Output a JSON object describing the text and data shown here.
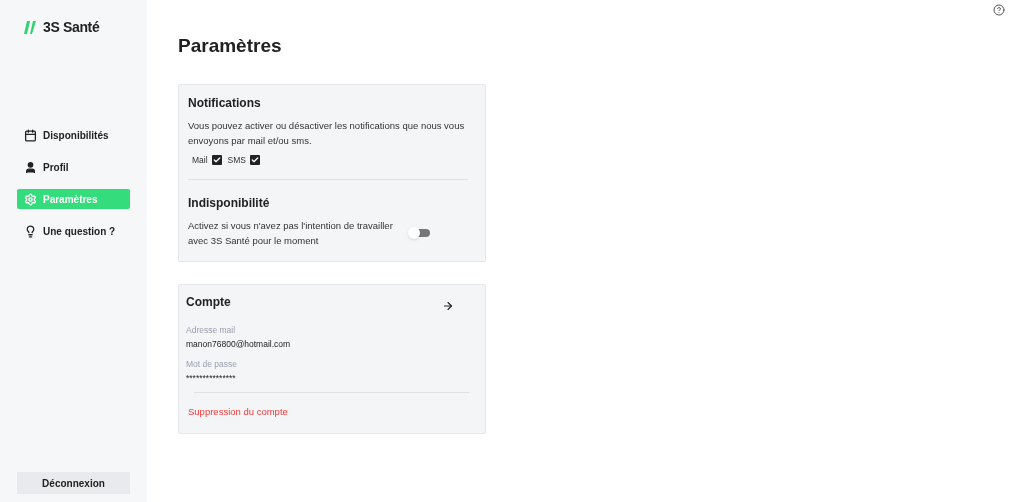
{
  "brand": {
    "name": "3S Santé"
  },
  "nav": [
    {
      "label": "Disponibilités",
      "kind": "calendar",
      "selected": false
    },
    {
      "label": "Profil",
      "kind": "user",
      "selected": false
    },
    {
      "label": "Paramètres",
      "kind": "gear",
      "selected": true
    },
    {
      "label": "Une question ?",
      "kind": "bulb",
      "selected": false
    }
  ],
  "logout": "Déconnexion",
  "page_title": "Paramètres",
  "notifications": {
    "title": "Notifications",
    "description": "Vous pouvez activer ou désactiver les notifications que nous vous envoyons par mail et/ou sms.",
    "options": [
      {
        "label": "Mail",
        "checked": true
      },
      {
        "label": "SMS",
        "checked": true
      }
    ]
  },
  "unavailability": {
    "title": "Indisponibilité",
    "description": "Activez si vous n'avez pas l'intention de travailler avec 3S Santé pour le moment",
    "on": false
  },
  "account": {
    "title": "Compte",
    "fields": [
      {
        "label": "Adresse mail",
        "value": "manon76800@hotmail.com"
      },
      {
        "label": "Mot de passe",
        "value": "***************"
      }
    ],
    "delete": "Suppression du compte"
  }
}
